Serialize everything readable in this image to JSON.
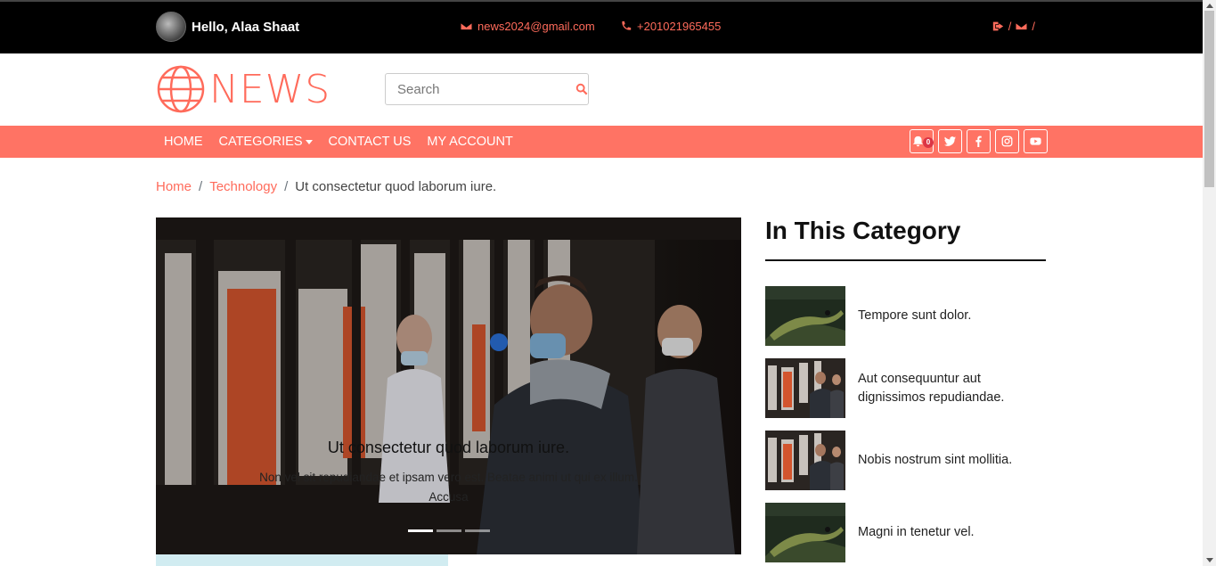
{
  "topbar": {
    "greeting": "Hello, Alaa Shaat",
    "email": "news2024@gmail.com",
    "phone": "+201021965455",
    "separator": "/"
  },
  "header": {
    "logo_text": "NEWS",
    "search_placeholder": "Search"
  },
  "nav": {
    "items": [
      "HOME",
      "CATEGORIES",
      "CONTACT US",
      "MY ACCOUNT"
    ],
    "notification_count": "0"
  },
  "breadcrumb": {
    "home": "Home",
    "category": "Technology",
    "current": "Ut consectetur quod laborum iure."
  },
  "carousel": {
    "title": "Ut consectetur quod laborum iure.",
    "text": "Non vel sit repudiandae et ipsam vero est. Beatae animi ut qui ex illum. Accusa"
  },
  "sidebar": {
    "title": "In This Category",
    "items": [
      {
        "title": "Tempore sunt dolor.",
        "image": "lizard"
      },
      {
        "title": "Aut consequuntur aut dignissimos repudiandae.",
        "image": "covid-test"
      },
      {
        "title": "Nobis nostrum sint mollitia.",
        "image": "covid-test"
      },
      {
        "title": "Magni in tenetur vel.",
        "image": "lizard"
      }
    ]
  },
  "colors": {
    "accent": "#ff7364",
    "topbar_bg": "#000000"
  }
}
